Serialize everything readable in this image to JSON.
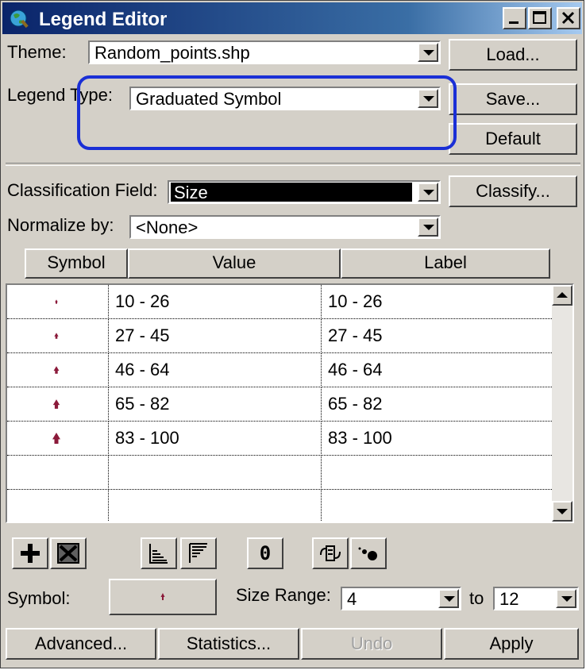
{
  "window": {
    "title": "Legend Editor",
    "controls": [
      "minimize",
      "maximize",
      "close"
    ]
  },
  "theme": {
    "label": "Theme:",
    "value": "Random_points.shp"
  },
  "legend_type": {
    "label": "Legend Type:",
    "value": "Graduated Symbol"
  },
  "buttons_top": {
    "load": "Load...",
    "save": "Save...",
    "default": "Default"
  },
  "classification": {
    "label": "Classification Field:",
    "value": "Size",
    "classify": "Classify..."
  },
  "normalize": {
    "label": "Normalize by:",
    "value": "<None>"
  },
  "table": {
    "headers": [
      "Symbol",
      "Value",
      "Label"
    ],
    "rows": [
      {
        "value": "10 - 26",
        "label": "10 - 26",
        "symbol_size": 1
      },
      {
        "value": "27 - 45",
        "label": "27 - 45",
        "symbol_size": 2
      },
      {
        "value": "46 - 64",
        "label": "46 - 64",
        "symbol_size": 3
      },
      {
        "value": "65 - 82",
        "label": "65 - 82",
        "symbol_size": 4
      },
      {
        "value": "83 - 100",
        "label": "83 - 100",
        "symbol_size": 5
      },
      {
        "value": "",
        "label": "",
        "symbol_size": 0
      },
      {
        "value": "",
        "label": "",
        "symbol_size": 0
      }
    ]
  },
  "toolbar": {
    "icons": [
      "add-class-icon",
      "delete-class-icon",
      "sort-ascending-icon",
      "sort-descending-icon",
      "null-value-icon",
      "reverse-symbols-icon",
      "symbol-size-icon"
    ],
    "null_label": "0"
  },
  "symbol": {
    "label": "Symbol:"
  },
  "size_range": {
    "label": "Size Range:",
    "from": "4",
    "to_label": "to",
    "to": "12"
  },
  "bottom_buttons": {
    "advanced": "Advanced...",
    "statistics": "Statistics...",
    "undo": "Undo",
    "apply": "Apply"
  },
  "colors": {
    "symbol": "#8b1a3a",
    "titlebar": "#0a246a",
    "highlight": "#1a2fd6"
  }
}
